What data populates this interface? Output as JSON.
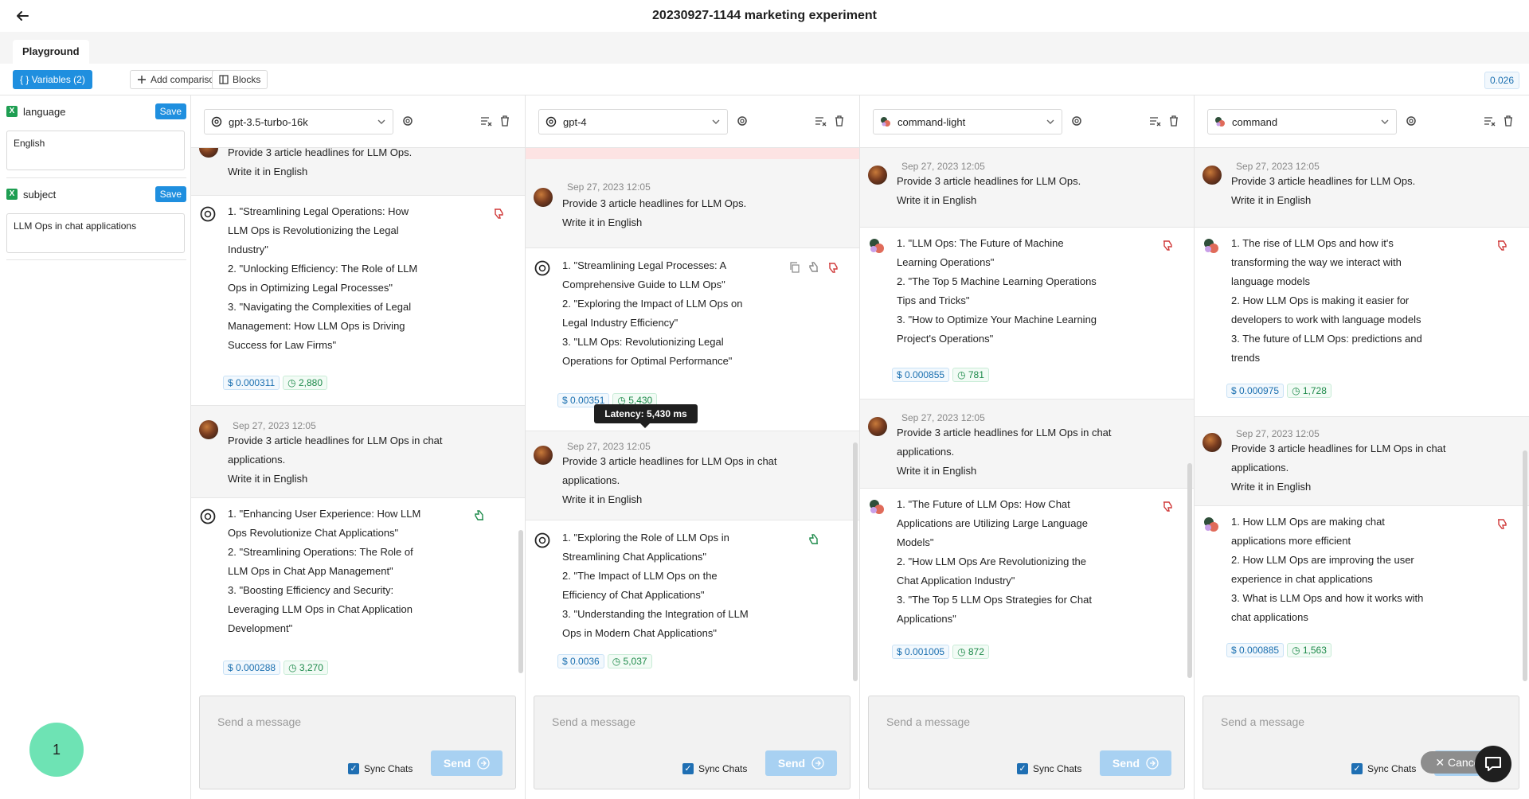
{
  "header": {
    "title": "20230927-1144 marketing experiment"
  },
  "tabs": [
    {
      "label": "Playground"
    }
  ],
  "toolbar": {
    "variables_label": "{ } Variables (2)",
    "add_comparison_label": "Add comparison",
    "blocks_label": "Blocks",
    "total_cost": "0.026"
  },
  "variables": [
    {
      "name": "language",
      "value": "English",
      "save_label": "Save"
    },
    {
      "name": "subject",
      "value": "LLM Ops in chat applications",
      "save_label": "Save"
    }
  ],
  "notification_count": "1",
  "tooltip": "Latency: 5,430 ms",
  "composer": {
    "placeholder": "Send a message",
    "sync_label": "Sync Chats",
    "send_label": "Send"
  },
  "cancel_label": "Cancel",
  "columns": [
    {
      "model": "gpt-3.5-turbo-16k",
      "messages": [
        {
          "role": "user",
          "lines": [
            "Provide 3 article headlines for LLM Ops.",
            "Write it in English"
          ]
        },
        {
          "role": "assistant",
          "lines": [
            "1. \"Streamlining Legal Operations: How",
            "LLM Ops is Revolutionizing the Legal",
            "Industry\"",
            "2. \"Unlocking Efficiency: The Role of LLM",
            "Ops in Optimizing Legal Processes\"",
            "3. \"Navigating the Complexities of Legal",
            "Management: How LLM Ops is Driving",
            "Success for Law Firms\""
          ],
          "cost": "$ 0.000311",
          "latency": "2,880",
          "rating": "down"
        },
        {
          "role": "user",
          "timestamp": "Sep 27, 2023 12:05",
          "lines": [
            "Provide 3 article headlines for LLM Ops in chat",
            "applications.",
            "Write it in English"
          ]
        },
        {
          "role": "assistant",
          "lines": [
            "1. \"Enhancing User Experience: How LLM",
            "Ops Revolutionize Chat Applications\"",
            "2. \"Streamlining Operations: The Role of",
            "LLM Ops in Chat App Management\"",
            "3. \"Boosting Efficiency and Security:",
            "Leveraging LLM Ops in Chat Application",
            "Development\""
          ],
          "cost": "$ 0.000288",
          "latency": "3,270",
          "rating": "up"
        }
      ]
    },
    {
      "model": "gpt-4",
      "messages": [
        {
          "role": "user",
          "timestamp": "Sep 27, 2023 12:05",
          "lines": [
            "Provide 3 article headlines for LLM Ops.",
            "Write it in English"
          ]
        },
        {
          "role": "assistant",
          "lines": [
            "1. \"Streamlining Legal Processes: A",
            "Comprehensive Guide to LLM Ops\"",
            "2. \"Exploring the Impact of LLM Ops on",
            "Legal Industry Efficiency\"",
            "3. \"LLM Ops: Revolutionizing Legal",
            "Operations for Optimal Performance\""
          ],
          "cost": "$ 0.00351",
          "latency": "5,430",
          "rating": "down"
        },
        {
          "role": "user",
          "timestamp": "Sep 27, 2023 12:05",
          "lines": [
            "Provide 3 article headlines for LLM Ops in chat",
            "applications.",
            "Write it in English"
          ]
        },
        {
          "role": "assistant",
          "lines": [
            "1. \"Exploring the Role of LLM Ops in",
            "Streamlining Chat Applications\"",
            "2. \"The Impact of LLM Ops on the",
            "Efficiency of Chat Applications\"",
            "3. \"Understanding the Integration of LLM",
            "Ops in Modern Chat Applications\""
          ],
          "cost": "$ 0.0036",
          "latency": "5,037",
          "rating": "up"
        }
      ]
    },
    {
      "model": "command-light",
      "messages": [
        {
          "role": "user",
          "timestamp": "Sep 27, 2023 12:05",
          "lines": [
            "Provide 3 article headlines for LLM Ops.",
            "Write it in English"
          ]
        },
        {
          "role": "assistant",
          "lines": [
            "1. \"LLM Ops: The Future of Machine",
            "Learning Operations\"",
            "2. \"The Top 5 Machine Learning Operations",
            "Tips and Tricks\"",
            "3. \"How to Optimize Your Machine Learning",
            "Project's Operations\""
          ],
          "cost": "$ 0.000855",
          "latency": "781",
          "rating": "down"
        },
        {
          "role": "user",
          "timestamp": "Sep 27, 2023 12:05",
          "lines": [
            "Provide 3 article headlines for LLM Ops in chat",
            "applications.",
            "Write it in English"
          ]
        },
        {
          "role": "assistant",
          "lines": [
            "1. \"The Future of LLM Ops: How Chat",
            "Applications are Utilizing Large Language",
            "Models\"",
            "2. \"How LLM Ops Are Revolutionizing the",
            "Chat Application Industry\"",
            "3. \"The Top 5 LLM Ops Strategies for Chat",
            "Applications\""
          ],
          "cost": "$ 0.001005",
          "latency": "872",
          "rating": "down"
        }
      ]
    },
    {
      "model": "command",
      "messages": [
        {
          "role": "user",
          "timestamp": "Sep 27, 2023 12:05",
          "lines": [
            "Provide 3 article headlines for LLM Ops.",
            "Write it in English"
          ]
        },
        {
          "role": "assistant",
          "lines": [
            "1. The rise of LLM Ops and how it's",
            "transforming the way we interact with",
            "language models",
            "2. How LLM Ops is making it easier for",
            "developers to work with language models",
            "3. The future of LLM Ops: predictions and",
            "trends"
          ],
          "cost": "$ 0.000975",
          "latency": "1,728",
          "rating": "down"
        },
        {
          "role": "user",
          "timestamp": "Sep 27, 2023 12:05",
          "lines": [
            "Provide 3 article headlines for LLM Ops in chat",
            "applications.",
            "Write it in English"
          ]
        },
        {
          "role": "assistant",
          "lines": [
            "1. How LLM Ops are making chat",
            "applications more efficient",
            "2. How LLM Ops are improving the user",
            "experience in chat applications",
            "3. What is LLM Ops and how it works with",
            "chat applications"
          ],
          "cost": "$ 0.000885",
          "latency": "1,563",
          "rating": "down"
        }
      ]
    }
  ],
  "icons": {
    "back": "arrow-left-icon",
    "settings": "gear-icon",
    "clear": "clear-chat-icon",
    "delete": "trash-icon",
    "openai": "openai-logo-icon",
    "cohere": "cohere-logo-icon",
    "thumbs_up": "thumbs-up-icon",
    "thumbs_down": "thumbs-down-icon",
    "copy": "copy-icon"
  },
  "colors": {
    "accent": "#1f8fdf",
    "thumb_up": "#1d8a4a",
    "thumb_down": "#d03a3a",
    "badge": "#6ee3b4"
  }
}
